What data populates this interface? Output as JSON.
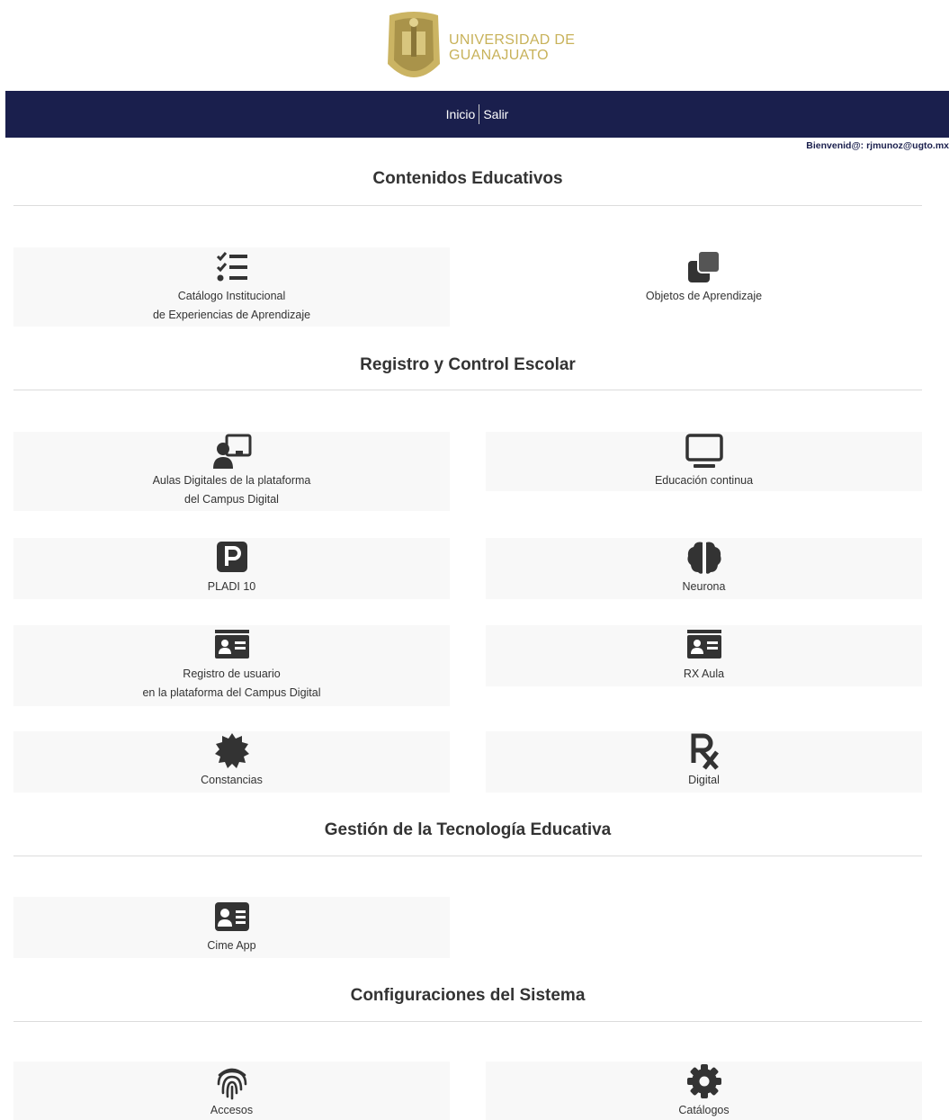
{
  "brand": {
    "line1": "UNIVERSIDAD DE",
    "line2": "GUANAJUATO",
    "color": "#c8b25a"
  },
  "nav": {
    "items": [
      "Inicio",
      "Salir"
    ],
    "bg": "#1a1f4d"
  },
  "welcome": "Bienvenid@: rjmunoz@ugto.mx",
  "sections": {
    "contenidos": {
      "title": "Contenidos Educativos",
      "cards": [
        {
          "line1": "Catálogo Institucional",
          "line2": "de Experiencias de Aprendizaje",
          "icon": "checklist-icon"
        },
        {
          "line1": "Objetos de Aprendizaje",
          "line2": "",
          "icon": "clone-icon"
        }
      ]
    },
    "registro": {
      "title": "Registro y Control Escolar",
      "cards": [
        {
          "line1": "Aulas Digitales de la plataforma",
          "line2": "del Campus Digital",
          "icon": "teacher-screen-icon"
        },
        {
          "line1": "Educación continua",
          "line2": "",
          "icon": "monitor-icon"
        },
        {
          "line1": "PLADI 10",
          "line2": "",
          "icon": "parking-square-icon"
        },
        {
          "line1": "Neurona",
          "line2": "",
          "icon": "brain-icon"
        },
        {
          "line1": "Registro de usuario",
          "line2": "en la plataforma del Campus Digital",
          "icon": "id-card-icon"
        },
        {
          "line1": "RX Aula",
          "line2": "",
          "icon": "id-card-icon"
        },
        {
          "line1": "Constancias",
          "line2": "",
          "icon": "certificate-icon"
        },
        {
          "line1": "Digital",
          "line2": "",
          "icon": "prescription-icon"
        }
      ]
    },
    "gestion": {
      "title": "Gestión de la Tecnología Educativa",
      "cards": [
        {
          "line1": "Cime App",
          "line2": "",
          "icon": "contact-card-icon"
        }
      ]
    },
    "config": {
      "title": "Configuraciones del Sistema",
      "cards": [
        {
          "line1": "Accesos",
          "line2": "",
          "icon": "fingerprint-icon"
        },
        {
          "line1": "Catálogos",
          "line2": "",
          "icon": "gear-icon"
        }
      ]
    }
  }
}
